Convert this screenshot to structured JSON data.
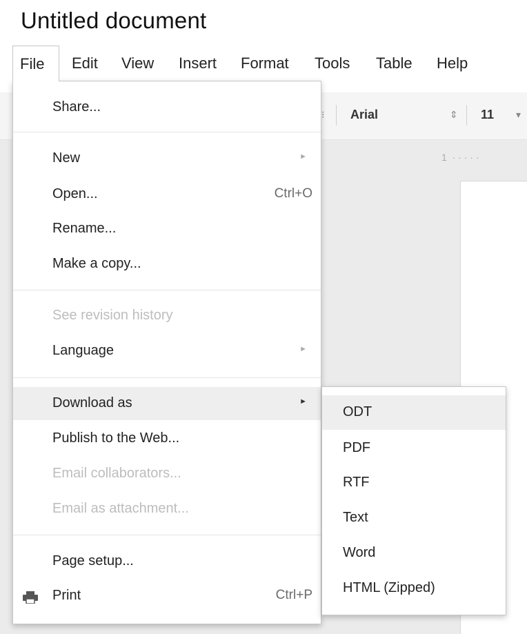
{
  "document": {
    "title": "Untitled document"
  },
  "menubar": {
    "items": [
      {
        "label": "File"
      },
      {
        "label": "Edit"
      },
      {
        "label": "View"
      },
      {
        "label": "Insert"
      },
      {
        "label": "Format"
      },
      {
        "label": "Tools"
      },
      {
        "label": "Table"
      },
      {
        "label": "Help"
      }
    ]
  },
  "toolbar": {
    "font_name": "Arial",
    "font_size": "11",
    "ruler_marker": "1"
  },
  "file_menu": {
    "share": "Share...",
    "new": "New",
    "open": "Open...",
    "open_shortcut": "Ctrl+O",
    "rename": "Rename...",
    "make_copy": "Make a copy...",
    "revision_history": "See revision history",
    "language": "Language",
    "download_as": "Download as",
    "publish": "Publish to the Web...",
    "email_collaborators": "Email collaborators...",
    "email_attachment": "Email as attachment...",
    "page_setup": "Page setup...",
    "print": "Print",
    "print_shortcut": "Ctrl+P"
  },
  "download_submenu": {
    "items": [
      {
        "label": "ODT"
      },
      {
        "label": "PDF"
      },
      {
        "label": "RTF"
      },
      {
        "label": "Text"
      },
      {
        "label": "Word"
      },
      {
        "label": "HTML (Zipped)"
      }
    ]
  },
  "colors": {
    "menu_border": "#c6c6c6",
    "highlight": "#eeeeee",
    "disabled_text": "#bdbdbd",
    "canvas_bg": "#ebebeb"
  }
}
